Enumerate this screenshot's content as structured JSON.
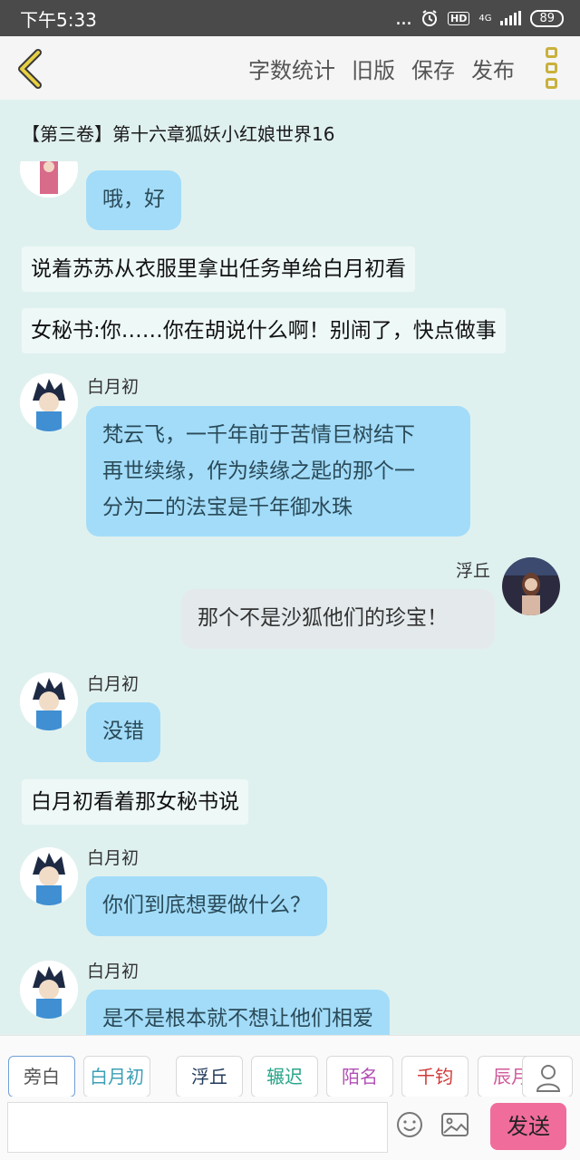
{
  "status_bar": {
    "time": "下午5:33",
    "dots": "...",
    "hd": "HD",
    "network": "4G",
    "battery": "89"
  },
  "header": {
    "actions": [
      "字数统计",
      "旧版",
      "保存",
      "发布"
    ]
  },
  "chat": {
    "chapter_title": "【第三卷】第十六章狐妖小红娘世界16",
    "messages": [
      {
        "kind": "bubble",
        "text": "哦，好"
      },
      {
        "kind": "narration",
        "text": "说着苏苏从衣服里拿出任务单给白月初看"
      },
      {
        "kind": "narration",
        "text": "女秘书:你……你在胡说什么啊！别闹了，快点做事"
      },
      {
        "kind": "bubble",
        "name": "白月初",
        "lines": [
          "梵云飞，一千年前于苦情巨树结下",
          "再世续缘，作为续缘之匙的那个一",
          "分为二的法宝是千年御水珠"
        ]
      },
      {
        "kind": "bubble-right",
        "name": "浮丘",
        "text": "那个不是沙狐他们的珍宝！"
      },
      {
        "kind": "bubble",
        "name": "白月初",
        "text": "没错"
      },
      {
        "kind": "narration",
        "text": "白月初看着那女秘书说"
      },
      {
        "kind": "bubble",
        "name": "白月初",
        "text": "你们到底想要做什么？"
      },
      {
        "kind": "bubble",
        "name": "白月初",
        "text": "是不是根本就不想让他们相爱"
      }
    ]
  },
  "roles": [
    {
      "label": "旁白",
      "color": "#555555"
    },
    {
      "label": "白月初",
      "color": "#3c9fb5"
    },
    {
      "label": "浮丘",
      "color": "#1f3a5a"
    },
    {
      "label": "辗迟",
      "color": "#2aa58a"
    },
    {
      "label": "陌名",
      "color": "#b24fb5"
    },
    {
      "label": "千钧",
      "color": "#d23a3a"
    },
    {
      "label": "辰月",
      "color": "#d05a9a"
    }
  ],
  "input": {
    "placeholder": "",
    "send_label": "发送"
  }
}
